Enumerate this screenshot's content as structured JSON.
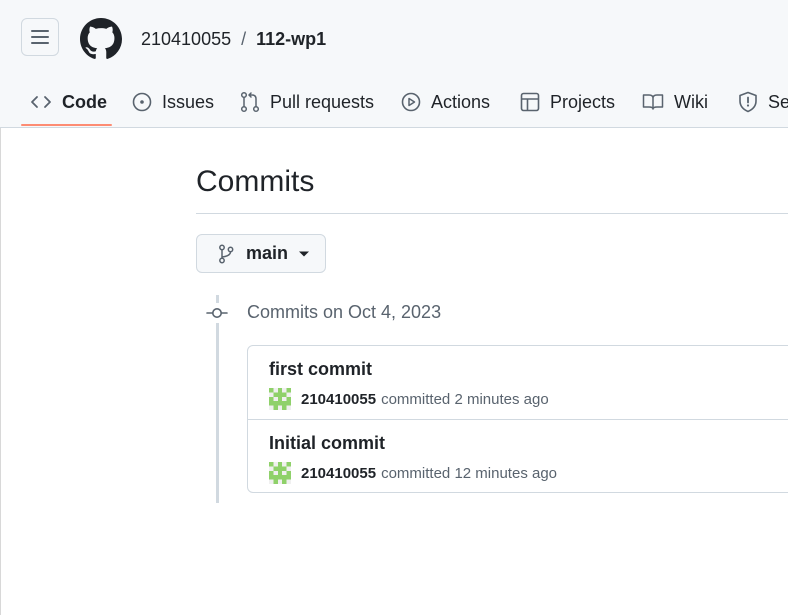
{
  "header": {
    "menu_icon": "hamburger-icon",
    "logo_icon": "github-logo-icon",
    "owner": "210410055",
    "separator": "/",
    "repo": "112-wp1"
  },
  "tabs": [
    {
      "label": "Code",
      "icon": "code-icon",
      "active": true
    },
    {
      "label": "Issues",
      "icon": "issue-opened-icon"
    },
    {
      "label": "Pull requests",
      "icon": "git-pull-request-icon"
    },
    {
      "label": "Actions",
      "icon": "play-icon"
    },
    {
      "label": "Projects",
      "icon": "table-icon"
    },
    {
      "label": "Wiki",
      "icon": "book-icon"
    },
    {
      "label": "Se",
      "icon": "shield-icon"
    }
  ],
  "page": {
    "title": "Commits",
    "branch": "main",
    "commits_date": "Commits on Oct 4, 2023"
  },
  "commits": [
    {
      "message": "first commit",
      "author": "210410055",
      "action": "committed 2 minutes ago"
    },
    {
      "message": "Initial commit",
      "author": "210410055",
      "action": "committed 12 minutes ago"
    }
  ],
  "colors": {
    "accent_underline": "#fd8c73",
    "header_bg": "#f6f8fa",
    "border": "#d1d9e0",
    "muted_text": "#59636e",
    "avatar_green": "#8fd16a"
  }
}
